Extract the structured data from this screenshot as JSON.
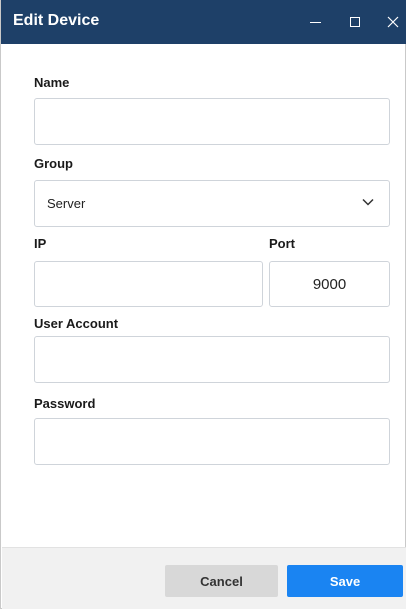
{
  "window": {
    "title": "Edit Device"
  },
  "form": {
    "name": {
      "label": "Name",
      "value": ""
    },
    "group": {
      "label": "Group",
      "value": "Server"
    },
    "ip": {
      "label": "IP",
      "value": ""
    },
    "port": {
      "label": "Port",
      "value": "9000"
    },
    "user_account": {
      "label": "User Account",
      "value": ""
    },
    "password": {
      "label": "Password",
      "value": ""
    }
  },
  "footer": {
    "cancel_label": "Cancel",
    "save_label": "Save"
  }
}
